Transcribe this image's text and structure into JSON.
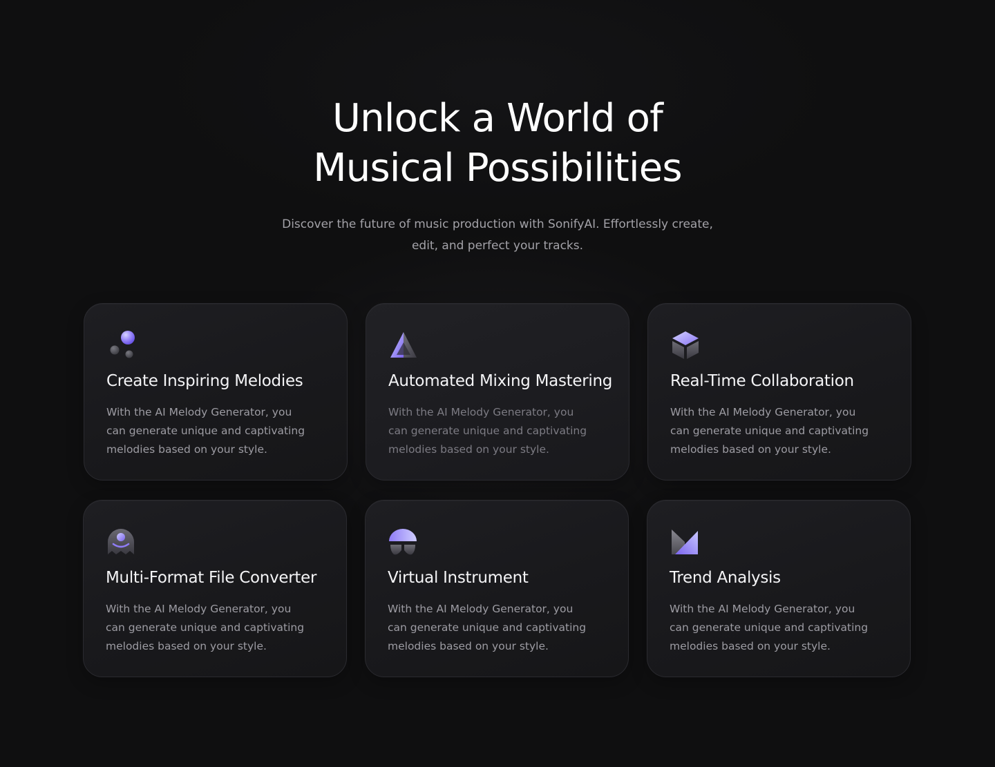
{
  "hero": {
    "title_line1": "Unlock a World of",
    "title_line2": "Musical Possibilities",
    "subtitle": "Discover the future of music production with SonifyAI. Effortlessly create, edit, and perfect your tracks."
  },
  "colors": {
    "background": "#0f0f10",
    "card": "#1c1c1f",
    "accent_purple": "#8b7cf6",
    "accent_blue": "#a5b4fc",
    "text_primary": "#ffffff",
    "text_secondary": "#9d9ca3"
  },
  "features": [
    {
      "icon": "orbs-icon",
      "title": "Create Inspiring Melodies",
      "description": "With the AI Melody Generator, you can generate unique and captivating melodies based on your style."
    },
    {
      "icon": "pyramid-icon",
      "title": "Automated Mixing Mastering",
      "description": "With the AI Melody Generator, you can generate unique and captivating melodies based on your style."
    },
    {
      "icon": "cube-icon",
      "title": "Real-Time Collaboration",
      "description": "With the AI Melody Generator, you can generate unique and captivating melodies based on your style."
    },
    {
      "icon": "ghost-icon",
      "title": "Multi-Format File Converter",
      "description": "With the AI Melody Generator, you can generate unique and captivating melodies based on your style."
    },
    {
      "icon": "dome-icon",
      "title": "Virtual Instrument",
      "description": "With the AI Melody Generator, you can generate unique and captivating melodies based on your style."
    },
    {
      "icon": "chart-icon",
      "title": "Trend Analysis",
      "description": "With the AI Melody Generator, you can generate unique and captivating melodies based on your style."
    }
  ]
}
